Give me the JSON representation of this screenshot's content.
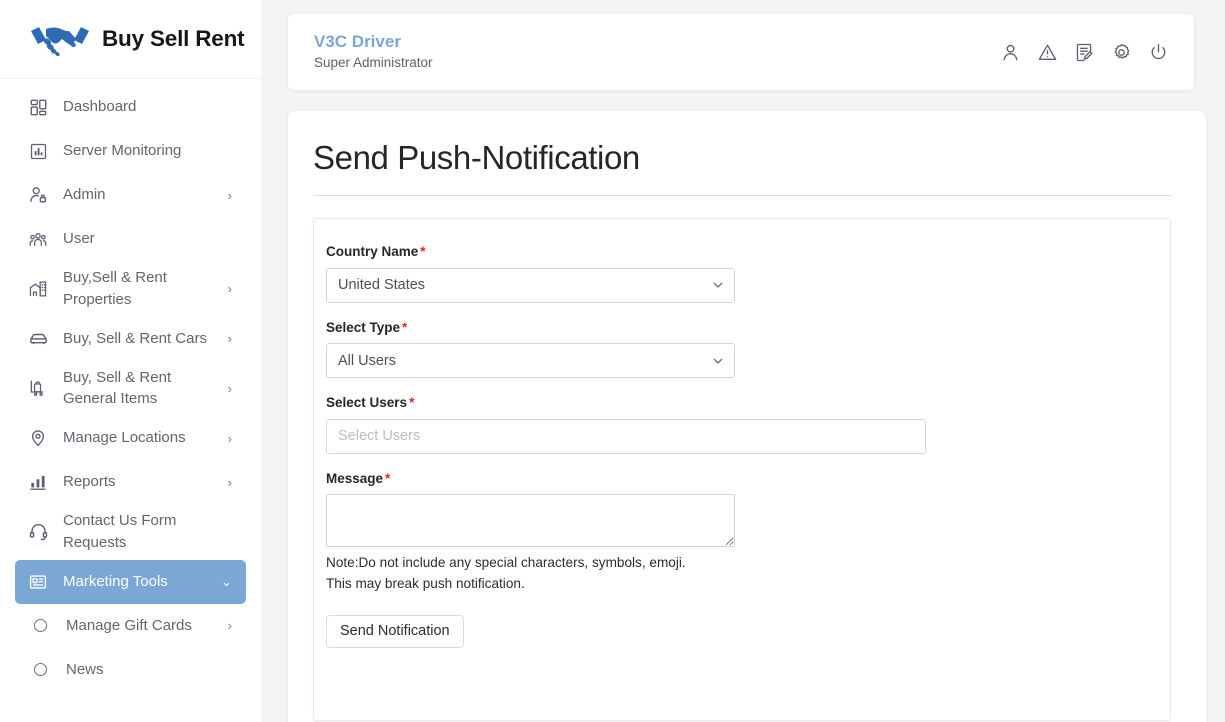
{
  "brand": {
    "name": "Buy Sell Rent",
    "logo_icon": "handshake-icon",
    "logo_color": "#2d6cb5"
  },
  "sidebar": {
    "active_item": "Marketing Tools",
    "active_color": "#7ba7d7",
    "items": [
      {
        "label": "Dashboard",
        "icon": "dashboard-grid-icon",
        "caret": "",
        "sub": false
      },
      {
        "label": "Server Monitoring",
        "icon": "chart-box-icon",
        "caret": "",
        "sub": false
      },
      {
        "label": "Admin",
        "icon": "user-lock-icon",
        "caret": "›",
        "sub": false
      },
      {
        "label": "User",
        "icon": "users-group-icon",
        "caret": "",
        "sub": false
      },
      {
        "label": "Buy,Sell & Rent Properties",
        "icon": "building-icon",
        "caret": "›",
        "sub": false
      },
      {
        "label": "Buy, Sell & Rent Cars",
        "icon": "car-icon",
        "caret": "›",
        "sub": false
      },
      {
        "label": "Buy, Sell & Rent General Items",
        "icon": "luggage-cart-icon",
        "caret": "›",
        "sub": false
      },
      {
        "label": "Manage Locations",
        "icon": "location-pin-icon",
        "caret": "›",
        "sub": false
      },
      {
        "label": "Reports",
        "icon": "bar-chart-icon",
        "caret": "›",
        "sub": false
      },
      {
        "label": "Contact Us Form Requests",
        "icon": "headset-icon",
        "caret": "",
        "sub": false
      },
      {
        "label": "Marketing Tools",
        "icon": "article-card-icon",
        "caret": "⌄",
        "sub": false
      },
      {
        "label": "Manage Gift Cards",
        "icon": "circle-bullet-icon",
        "caret": "›",
        "sub": true
      },
      {
        "label": "News",
        "icon": "circle-bullet-icon",
        "caret": "",
        "sub": true
      }
    ]
  },
  "topbar": {
    "title": "V3C Driver",
    "subtitle": "Super Administrator",
    "title_color": "#7ea5d8",
    "icons": [
      {
        "name": "user-icon"
      },
      {
        "name": "warning-triangle-icon"
      },
      {
        "name": "edit-document-icon"
      },
      {
        "name": "gear-icon"
      },
      {
        "name": "power-icon"
      }
    ]
  },
  "page": {
    "title": "Send Push-Notification"
  },
  "form": {
    "required_marker": "*",
    "required_color": "#f52119",
    "country": {
      "label": "Country Name",
      "value": "United States",
      "options": [
        "United States"
      ]
    },
    "type": {
      "label": "Select Type",
      "value": "All Users",
      "options": [
        "All Users"
      ]
    },
    "users": {
      "label": "Select Users",
      "value": "",
      "placeholder": "Select Users"
    },
    "message": {
      "label": "Message",
      "value": ""
    },
    "note_line1": "Note:Do not include any special characters, symbols, emoji.",
    "note_line2": "This may break push notification.",
    "submit_label": "Send Notification"
  }
}
